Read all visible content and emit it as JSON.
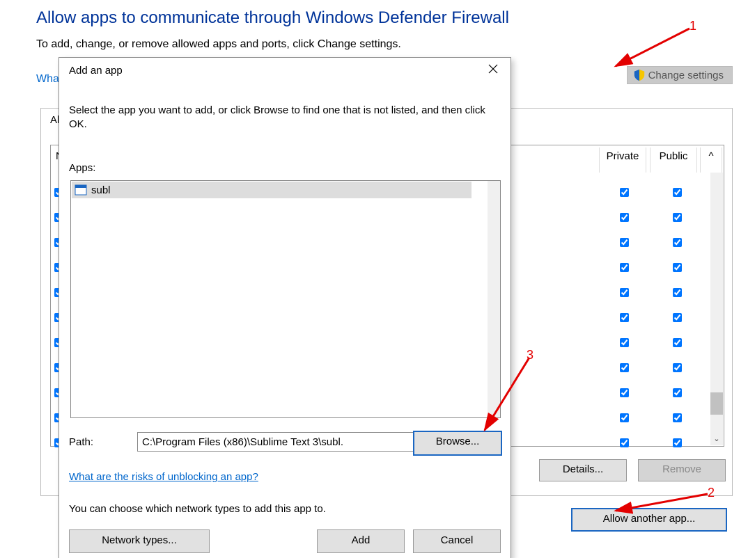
{
  "background": {
    "heading": "Allow apps to communicate through Windows Defender Firewall",
    "subtitle": "To add, change, or remove allowed apps and ports, click Change settings.",
    "what_link": "Wha",
    "change_settings_label": "Change settings",
    "group_title": "Al",
    "col_name_char": "N",
    "col_private": "Private",
    "col_public": "Public",
    "col_up": "^",
    "scroll_down": "⌄",
    "details_label": "Details...",
    "remove_label": "Remove",
    "allow_another_label": "Allow another app...",
    "rows": [
      {
        "name_checked": true,
        "private": true,
        "public": true
      },
      {
        "name_checked": true,
        "private": true,
        "public": true
      },
      {
        "name_checked": true,
        "private": true,
        "public": true
      },
      {
        "name_checked": true,
        "private": true,
        "public": true
      },
      {
        "name_checked": true,
        "private": true,
        "public": true
      },
      {
        "name_checked": true,
        "private": true,
        "public": true
      },
      {
        "name_checked": true,
        "private": true,
        "public": true
      },
      {
        "name_checked": true,
        "private": true,
        "public": true
      },
      {
        "name_checked": true,
        "private": true,
        "public": true
      },
      {
        "name_checked": true,
        "private": true,
        "public": true
      },
      {
        "name_checked": true,
        "private": true,
        "public": true
      }
    ]
  },
  "dialog": {
    "title": "Add an app",
    "instructions": "Select the app you want to add, or click Browse to find one that is not listed, and then click OK.",
    "apps_label": "Apps:",
    "selected_app": "subl",
    "path_label": "Path:",
    "path_value": "C:\\Program Files (x86)\\Sublime Text 3\\subl.",
    "browse_label": "Browse...",
    "risks_link": "What are the risks of unblocking an app?",
    "net_text": "You can choose which network types to add this app to.",
    "net_types_label": "Network types...",
    "add_label": "Add",
    "cancel_label": "Cancel"
  },
  "annotations": {
    "one": "1",
    "two": "2",
    "three": "3"
  }
}
